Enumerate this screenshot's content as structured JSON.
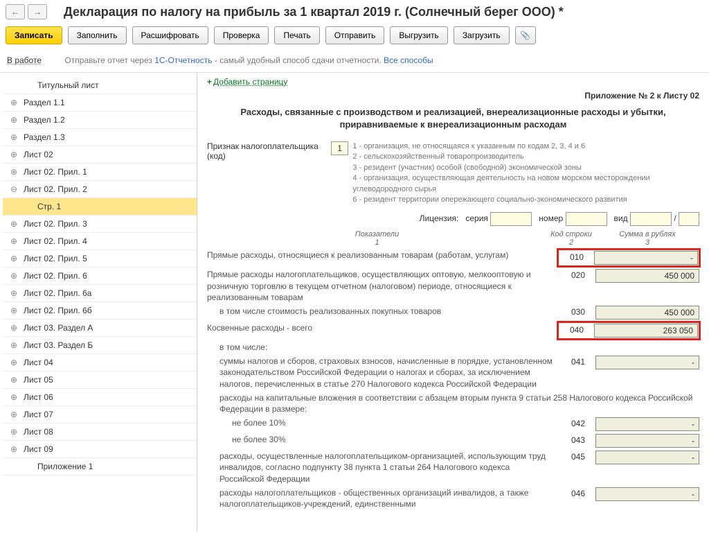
{
  "header": {
    "title": "Декларация по налогу на прибыль за 1 квартал 2019 г. (Солнечный берег ООО) *"
  },
  "toolbar": {
    "record": "Записать",
    "fill": "Заполнить",
    "decode": "Расшифровать",
    "check": "Проверка",
    "print": "Печать",
    "send": "Отправить",
    "export": "Выгрузить",
    "import": "Загрузить"
  },
  "status": {
    "left": "В работе",
    "text1": "Отправьте отчет через ",
    "link1": "1С-Отчетность",
    "text2": " - самый удобный способ сдачи отчетности. ",
    "link2": "Все способы"
  },
  "tree": {
    "c0": "Титульный лист",
    "c1": "Раздел 1.1",
    "c2": "Раздел 1.2",
    "c3": "Раздел 1.3",
    "c4": "Лист 02",
    "c5": "Лист 02. Прил. 1",
    "c6": "Лист 02. Прил. 2",
    "c7": "Стр. 1",
    "c8": "Лист 02. Прил. 3",
    "c9": "Лист 02. Прил. 4",
    "c10": "Лист 02. Прил. 5",
    "c11": "Лист 02. Прил. 6",
    "c12": "Лист 02. Прил. 6а",
    "c13": "Лист 02. Прил. 6б",
    "c14": "Лист 03. Раздел А",
    "c15": "Лист 03. Раздел Б",
    "c16": "Лист 04",
    "c17": "Лист 05",
    "c18": "Лист 06",
    "c19": "Лист 07",
    "c20": "Лист 08",
    "c21": "Лист 09",
    "c22": "Приложение 1"
  },
  "main": {
    "add_page": "Добавить страницу",
    "app_label": "Приложение № 2 к Листу 02",
    "heading": "Расходы, связанные с производством и реализацией, внереализационные расходы и убытки, приравниваемые к внереализационным расходам",
    "taxpayer_label": "Признак налогоплательщика (код)",
    "taxpayer_code": "1",
    "hints": {
      "h1": "1 - организация, не относящаяся к указанным по кодам 2, 3, 4 и 6",
      "h2": "2 - сельскохозяйственный товаропроизводитель",
      "h3": "3 - резидент (участник) особой (свободной) экономической зоны",
      "h4": "4 - организация, осуществляющая деятельность на новом морском месторождении углеводородного сырья",
      "h6": "6 - резидент территории опережающего социально-экономического развития"
    },
    "license": {
      "label": "Лицензия:",
      "series": "серия",
      "number": "номер",
      "type": "вид",
      "slash": "/"
    },
    "cols": {
      "ind": "Показатели",
      "ind_n": "1",
      "code": "Код строки",
      "code_n": "2",
      "sum": "Сумма в рублях",
      "sum_n": "3"
    },
    "lines": {
      "l010": {
        "desc": "Прямые расходы, относящиеся к реализованным товарам (работам, услугам)",
        "code": "010",
        "sum": "-"
      },
      "l020": {
        "desc": "Прямые расходы налогоплательщиков, осуществляющих оптовую, мелкооптовую и розничную торговлю в текущем отчетном (налоговом) периоде, относящиеся к реализованным товарам",
        "code": "020",
        "sum": "450 000"
      },
      "l030": {
        "desc": "в том числе стоимость реализованных покупных товаров",
        "code": "030",
        "sum": "450 000"
      },
      "l040": {
        "desc": "Косвенные расходы - всего",
        "code": "040",
        "sum": "263 050"
      },
      "incl": "в том числе:",
      "l041": {
        "desc": "суммы налогов и сборов, страховых взносов, начисленные в порядке, установленном законодательством Российской Федерации о налогах и сборах, за исключением налогов, перечисленных в статье 270 Налогового кодекса Российской Федерации",
        "code": "041",
        "sum": "-"
      },
      "capex": "расходы на капитальные вложения в соответствии с абзацем вторым пункта 9 статьи 258 Налогового кодекса Российской Федерации в размере:",
      "l042": {
        "desc": "не более 10%",
        "code": "042",
        "sum": "-"
      },
      "l043": {
        "desc": "не более 30%",
        "code": "043",
        "sum": "-"
      },
      "l045": {
        "desc": "расходы, осуществленные налогоплательщиком-организацией, использующим труд инвалидов, согласно подпункту 38 пункта 1 статьи 264 Налогового кодекса Российской Федерации",
        "code": "045",
        "sum": "-"
      },
      "l046": {
        "desc": "расходы налогоплательщиков - общественных организаций инвалидов, а также налогоплательщиков-учреждений, единственными",
        "code": "046",
        "sum": "-"
      }
    }
  }
}
